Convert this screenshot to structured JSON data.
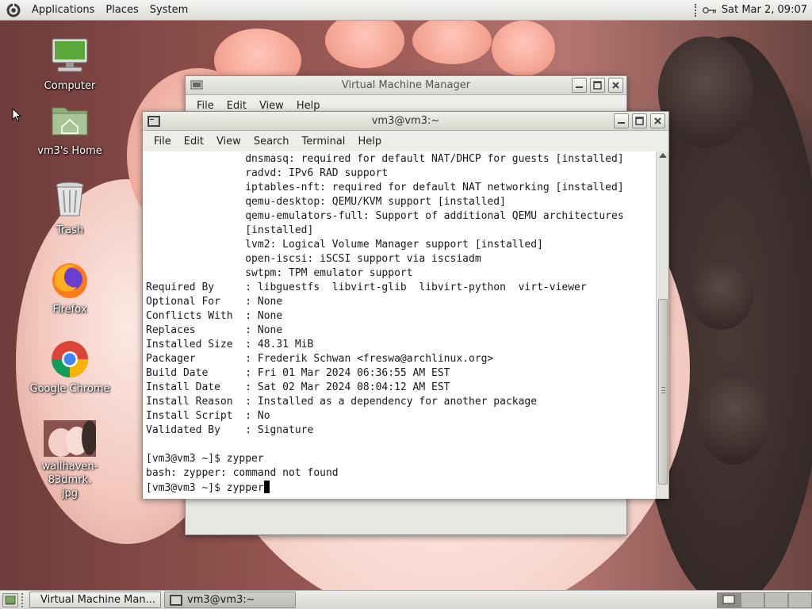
{
  "top_panel": {
    "menus": [
      "Applications",
      "Places",
      "System"
    ],
    "clock": "Sat Mar 2, 09:07"
  },
  "desktop_icons": [
    {
      "label": "Computer",
      "icon": "computer-icon"
    },
    {
      "label": "vm3's Home",
      "icon": "home-folder-icon"
    },
    {
      "label": "Trash",
      "icon": "trash-icon"
    },
    {
      "label": "Firefox",
      "icon": "firefox-icon"
    },
    {
      "label": "Google Chrome",
      "icon": "chrome-icon"
    },
    {
      "label": "wallhaven-83dmrk.jpg",
      "label_lines": [
        "wallhaven-83dmrk.",
        "jpg"
      ],
      "icon": "image-thumbnail-icon"
    }
  ],
  "vmm_window": {
    "title": "Virtual Machine Manager",
    "menu": [
      "File",
      "Edit",
      "View",
      "Help"
    ]
  },
  "terminal_window": {
    "title": "vm3@vm3:~",
    "menu": [
      "File",
      "Edit",
      "View",
      "Search",
      "Terminal",
      "Help"
    ],
    "lines": [
      "                dnsmasq: required for default NAT/DHCP for guests [installed]",
      "                radvd: IPv6 RAD support",
      "                iptables-nft: required for default NAT networking [installed]",
      "                qemu-desktop: QEMU/KVM support [installed]",
      "                qemu-emulators-full: Support of additional QEMU architectures",
      "                [installed]",
      "                lvm2: Logical Volume Manager support [installed]",
      "                open-iscsi: iSCSI support via iscsiadm",
      "                swtpm: TPM emulator support",
      "Required By     : libguestfs  libvirt-glib  libvirt-python  virt-viewer",
      "Optional For    : None",
      "Conflicts With  : None",
      "Replaces        : None",
      "Installed Size  : 48.31 MiB",
      "Packager        : Frederik Schwan <freswa@archlinux.org>",
      "Build Date      : Fri 01 Mar 2024 06:36:55 AM EST",
      "Install Date    : Sat 02 Mar 2024 08:04:12 AM EST",
      "Install Reason  : Installed as a dependency for another package",
      "Install Script  : No",
      "Validated By    : Signature",
      "",
      "[vm3@vm3 ~]$ zypper",
      "bash: zypper: command not found"
    ],
    "prompt_line": "[vm3@vm3 ~]$ zypper"
  },
  "taskbar": {
    "tasks": [
      {
        "label": "Virtual Machine Man...",
        "icon": "vmm-icon",
        "active": false
      },
      {
        "label": "vm3@vm3:~",
        "icon": "terminal-icon",
        "active": true
      }
    ]
  },
  "colors": {
    "panel_bg": "#dcdcd8",
    "terminal_bg": "#ffffff",
    "terminal_fg": "#1a1a1a"
  }
}
